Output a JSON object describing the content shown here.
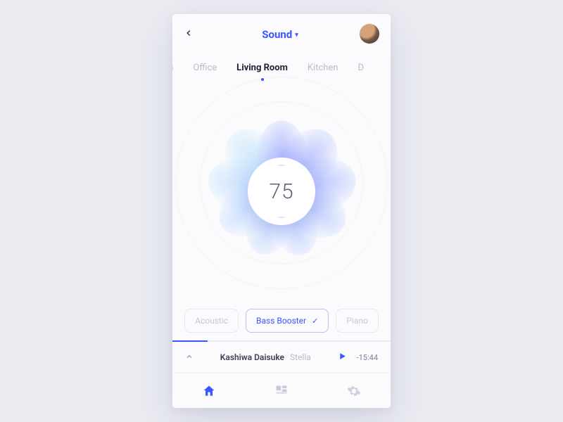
{
  "header": {
    "title": "Sound"
  },
  "rooms": {
    "items": [
      "m",
      "Office",
      "Living Room",
      "Kitchen",
      "D"
    ],
    "active_index": 2
  },
  "dial": {
    "value": "75"
  },
  "presets": {
    "items": [
      "Acoustic",
      "Bass Booster",
      "Piano"
    ],
    "active_index": 1
  },
  "player": {
    "artist": "Kashiwa Daisuke",
    "song": "Stella",
    "time_remaining": "-15:44",
    "progress_pct": 16
  },
  "colors": {
    "accent": "#3a57ff"
  }
}
